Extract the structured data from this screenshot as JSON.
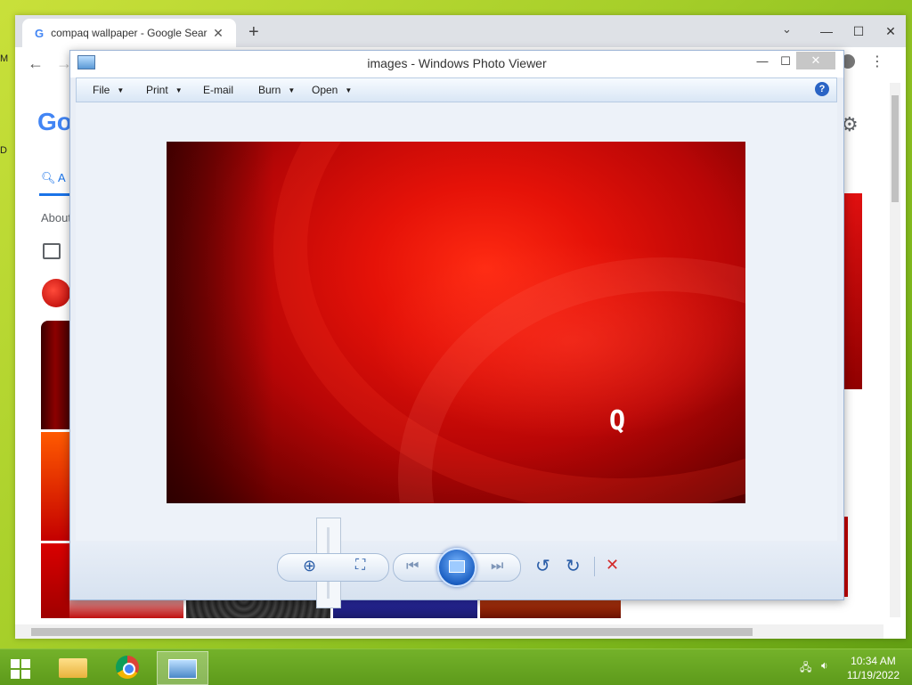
{
  "desktop": {
    "frag_top": "M",
    "frag_mid": "D"
  },
  "chrome": {
    "tab_title": "compaq wallpaper - Google Search",
    "tab_logo": "G",
    "new_tab": "+",
    "tab_dropdown": "⌄",
    "back": "←",
    "forward": "→",
    "google_partial": "Go",
    "search_tab_partial": "A",
    "about_partial": "About",
    "window_minimize": "—",
    "window_maximize": "☐",
    "window_close": "✕"
  },
  "photo_viewer": {
    "title": "images - Windows Photo Viewer",
    "menu": {
      "file": "File",
      "print": "Print",
      "email": "E-mail",
      "burn": "Burn",
      "open": "Open"
    },
    "help": "?",
    "photo_logo": "Q",
    "controls": {
      "zoom": "⊕",
      "actual_size": "⛶",
      "previous": "⏮",
      "next": "⏭",
      "rotate_ccw": "↺",
      "rotate_cw": "↻",
      "delete": "✕"
    },
    "zoom_level": 0.5
  },
  "taskbar": {
    "time": "10:34 AM",
    "date": "11/19/2022"
  },
  "colors": {
    "desktop_green": "#a7cf2a",
    "taskbar_green": "#5d9a1b",
    "photo_red": "#e51208",
    "accent_blue": "#1b5fc2"
  }
}
